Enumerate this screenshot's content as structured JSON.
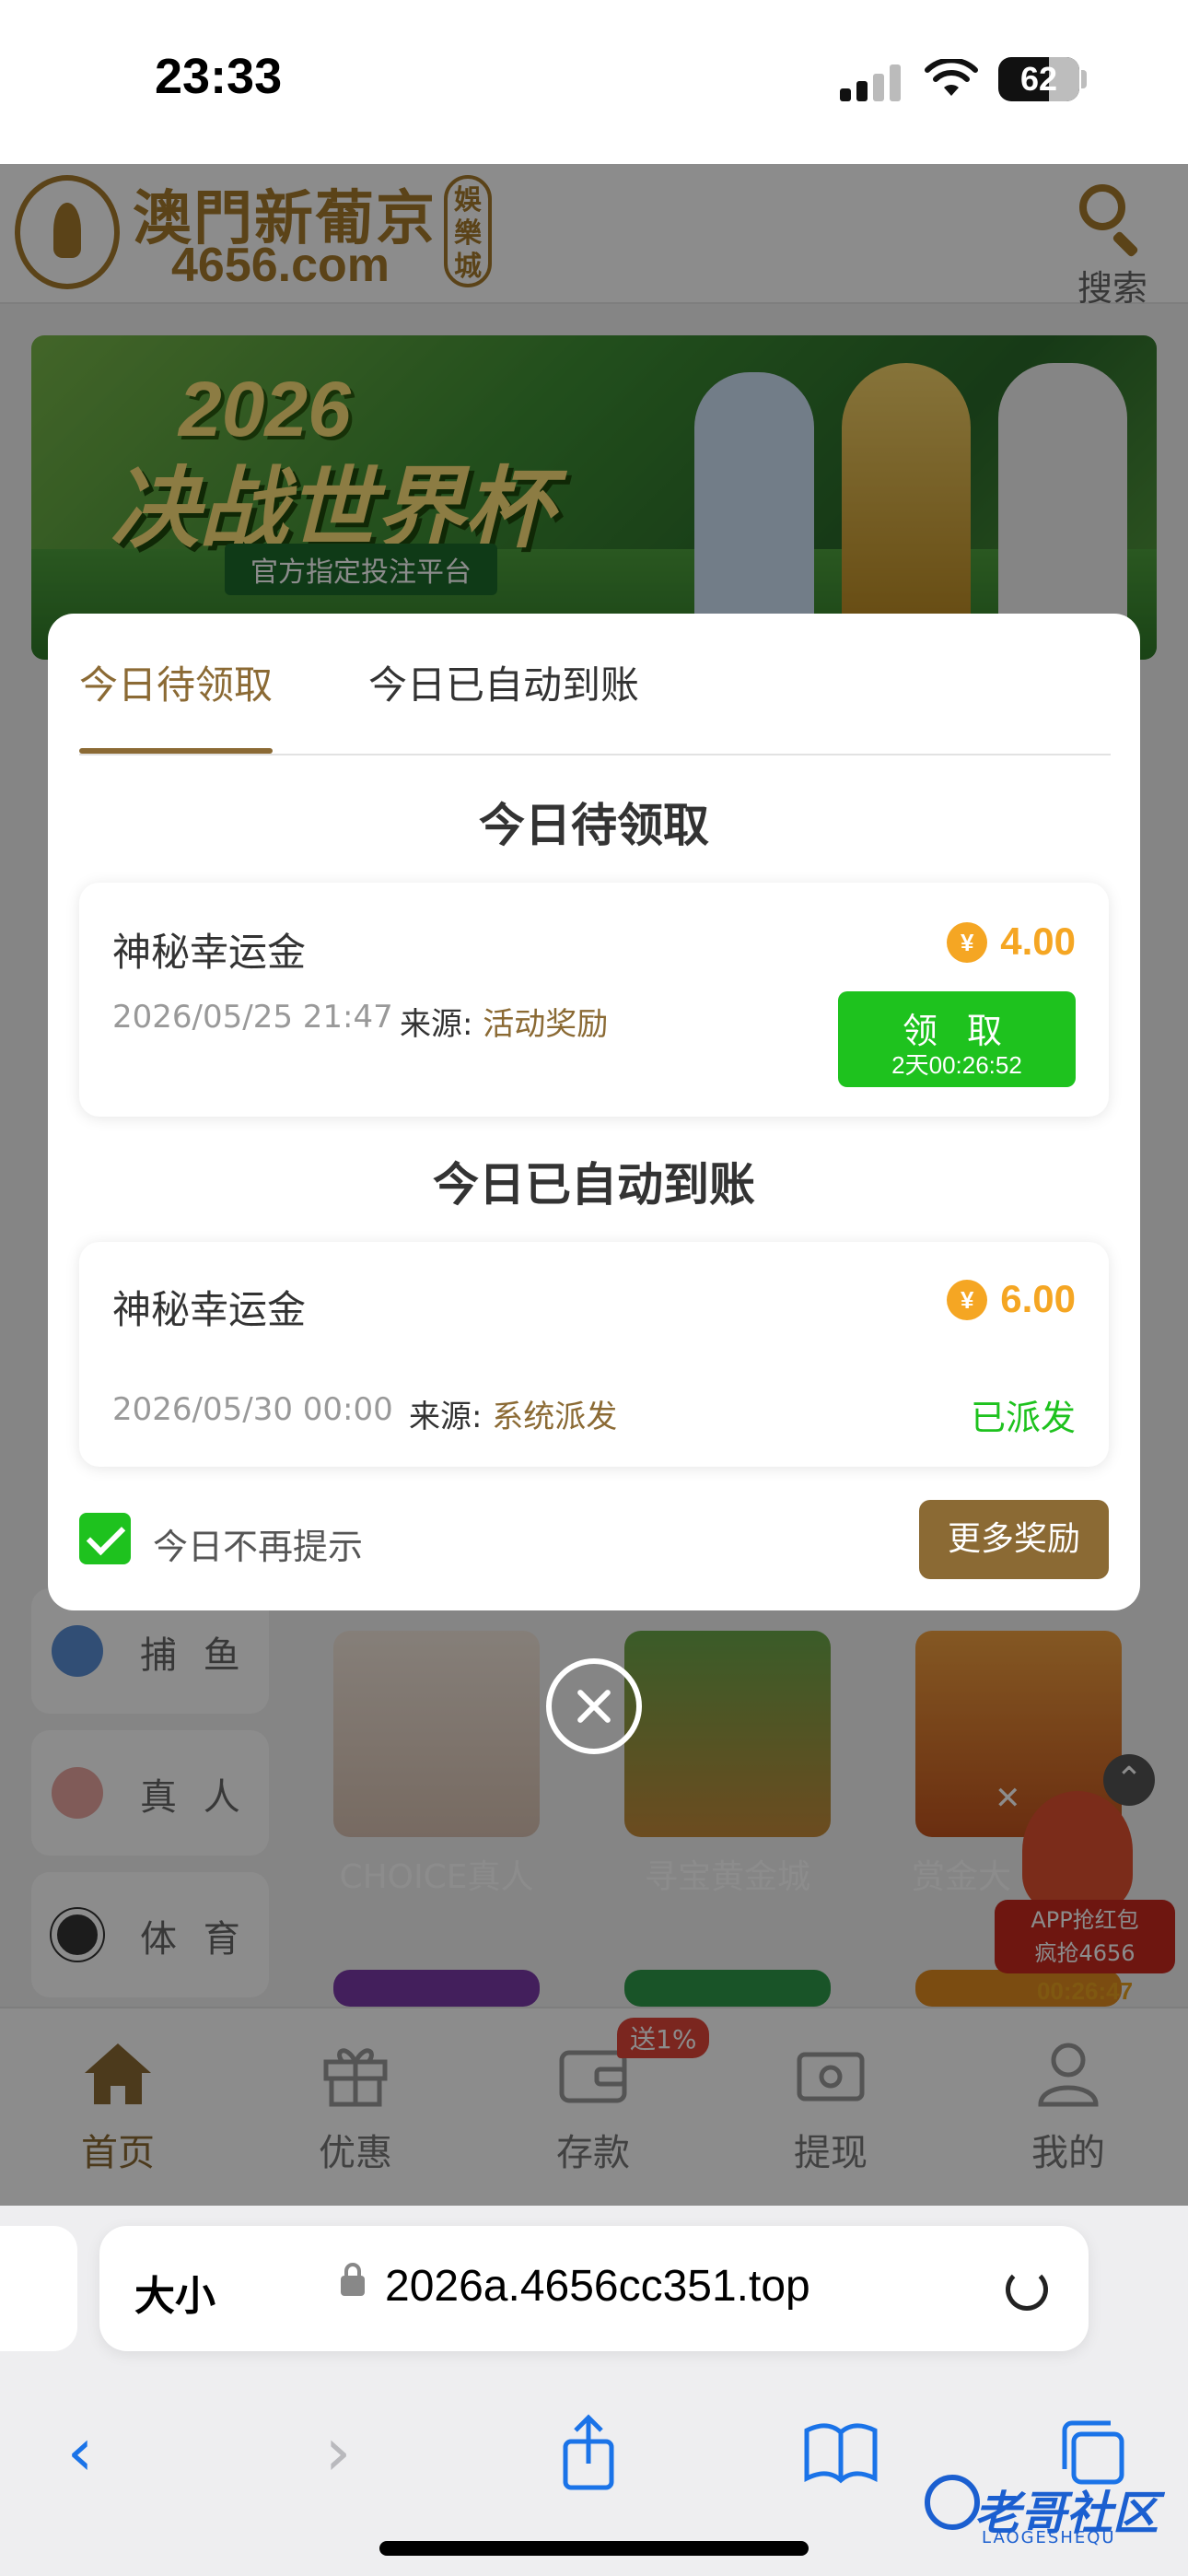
{
  "status_bar": {
    "time": "23:33",
    "battery": "62",
    "battery_level": 0.62
  },
  "site": {
    "logo_name": "澳門新葡京",
    "logo_domain": "4656.com",
    "logo_seal": "娛樂城",
    "search_label": "搜索"
  },
  "banner": {
    "year": "2026",
    "title": "决战世界杯",
    "subtitle": "官方指定投注平台"
  },
  "modal": {
    "tabs": [
      "今日待领取",
      "今日已自动到账"
    ],
    "pending": {
      "title": "今日待领取",
      "item": {
        "name": "神秘幸运金",
        "currency_icon": "¥",
        "amount": "4.00",
        "date": "2026/05/25 21:47",
        "source_label": "来源: ",
        "source_value": "活动奖励",
        "button_label": "领 取",
        "countdown": "2天00:26:52"
      }
    },
    "auto": {
      "title": "今日已自动到账",
      "item": {
        "name": "神秘幸运金",
        "currency_icon": "¥",
        "amount": "6.00",
        "date": "2026/05/30 00:00",
        "source_label": "来源: ",
        "source_value": "系统派发",
        "status": "已派发"
      }
    },
    "dont_show_label": "今日不再提示",
    "dont_show_checked": true,
    "more_button": "更多奖励"
  },
  "categories": [
    "捕 鱼",
    "真 人",
    "体 育"
  ],
  "games": [
    "CHOICE真人",
    "寻宝黄金城",
    "赏金大"
  ],
  "floating_promo": {
    "line1": "APP抢红包",
    "line2": "疯抢4656",
    "countdown": "00:26:47"
  },
  "tabbar": {
    "items": [
      "首页",
      "优惠",
      "存款",
      "提现",
      "我的"
    ],
    "active": "首页",
    "deposit_badge": "送1%"
  },
  "browser": {
    "text_size_label": "大小",
    "url": "2026a.4656cc351.top"
  },
  "watermark": {
    "text": "老哥社区",
    "sub": "LAOGESHEQU"
  },
  "colors": {
    "accent": "#8b6a34",
    "green": "#1ec21e",
    "coin": "#f5a623",
    "link_blue": "#1a73e8"
  }
}
